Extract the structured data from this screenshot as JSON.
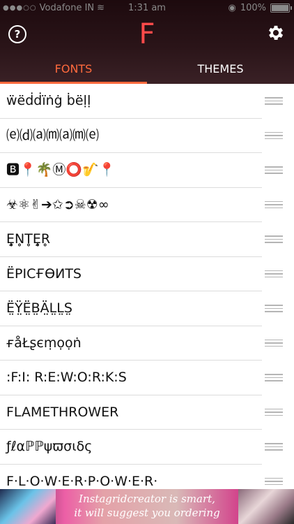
{
  "status": {
    "carrier": "Vodafone IN",
    "time": "1:31 am",
    "battery": "100%"
  },
  "header": {
    "logo": "F",
    "help_glyph": "?"
  },
  "tabs": {
    "fonts_label": "FONTS",
    "themes_label": "THEMES",
    "active": "FONTS"
  },
  "fonts": [
    "ẅëḋḋïṅġ ḃëḷḷ",
    "⒠⒟⒜⒨⒜⒨⒠",
    "🅱📍🌴Ⓜ⭕🎷📍",
    "☣⚛✌➔✩➲☠☢∞",
    "Ȩ̥N̥T̥Ȩ̥R̥",
    "ЁРІСҒӨИТЅ",
    "Ë̤Ÿ̤Ë̤B̤Ä̤L̤L̤S̤",
    "ғåŁʂєṃọọṅ",
    ":F:I: R:E:W:O:R:K:S",
    "FLAMETHROWER",
    "ƒℓαℙℙψϖσιδς",
    "F·L·O·W·E·R·P·O·W·E·R·"
  ],
  "ad": {
    "line1": "Instagridcreator is smart,",
    "line2": "it will suggest you ordering"
  },
  "colors": {
    "accent": "#ff6a3d",
    "logo": "#ff4a4a",
    "header_bg": "#2a1418"
  }
}
